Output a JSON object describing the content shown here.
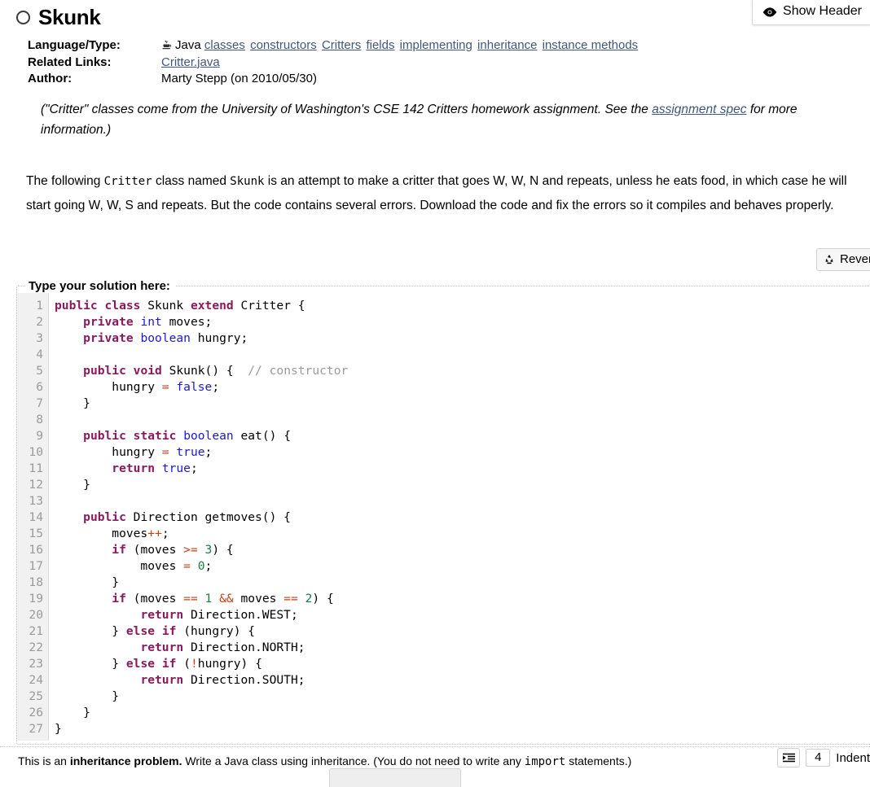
{
  "show_header": {
    "label": "Show Header",
    "icon": "eye-icon"
  },
  "header": {
    "title": "Skunk",
    "status_icon": "empty-circle-icon"
  },
  "meta": {
    "rows": [
      {
        "label": "Language/Type:",
        "kind": "tags"
      },
      {
        "label": "Related Links:",
        "kind": "links"
      },
      {
        "label": "Author:",
        "kind": "text"
      }
    ],
    "language": {
      "icon": "java-cup-icon",
      "name": "Java",
      "tags": [
        "classes",
        "constructors",
        "Critters",
        "fields",
        "implementing",
        "inheritance",
        "instance methods"
      ]
    },
    "related_links": [
      "Critter.java"
    ],
    "author": "Marty Stepp (on 2010/05/30)"
  },
  "note": {
    "before_link": "(\"Critter\" classes come from the University of Washington's CSE 142 Critters homework assignment. See the ",
    "link": "assignment spec",
    "after_link": " for more information.)"
  },
  "description": {
    "seg1": "The following ",
    "code1": "Critter",
    "seg2": " class named ",
    "code2": "Skunk",
    "seg3": " is an attempt to make a critter that goes W, W, N and repeats, unless he eats food, in which case he will start going W, W, S and repeats. But the code contains several errors. Download the code and fix the errors so it compiles and behaves properly."
  },
  "revert": {
    "label": "Revert",
    "icon": "recycle-icon"
  },
  "editor": {
    "legend": "Type your solution here:",
    "line_numbers": [
      1,
      2,
      3,
      4,
      5,
      6,
      7,
      8,
      9,
      10,
      11,
      12,
      13,
      14,
      15,
      16,
      17,
      18,
      19,
      20,
      21,
      22,
      23,
      24,
      25,
      26,
      27
    ],
    "lines": [
      "public class Skunk extend Critter {",
      "    private int moves;",
      "    private boolean hungry;",
      "",
      "    public void Skunk() {  // constructor",
      "        hungry = false;",
      "    }",
      "",
      "    public static boolean eat() {",
      "        hungry = true;",
      "        return true;",
      "    }",
      "",
      "    public Direction getmoves() {",
      "        moves++;",
      "        if (moves >= 3) {",
      "            moves = 0;",
      "        }",
      "        if (moves == 1 && moves == 2) {",
      "            return Direction.WEST;",
      "        } else if (hungry) {",
      "            return Direction.NORTH;",
      "        } else if (!hungry) {",
      "            return Direction.SOUTH;",
      "        }",
      "    }",
      "}"
    ],
    "colors": {
      "keyword": "#8a1a5e",
      "type": "#1a1ad6",
      "comment": "#999999",
      "operator": "#c2401a",
      "number": "#1d7a4b",
      "gutter_bg": "#f1f1f1",
      "gutter_text": "#9a9a9a"
    }
  },
  "footer": {
    "seg1": "This is an ",
    "bold": "inheritance problem.",
    "seg2": " Write a Java class using inheritance. (You do not need to write any ",
    "code": "import",
    "seg3": " statements.)",
    "indent_icon": "indent-icon",
    "indent_size": "4",
    "indent_label": "Indent"
  }
}
